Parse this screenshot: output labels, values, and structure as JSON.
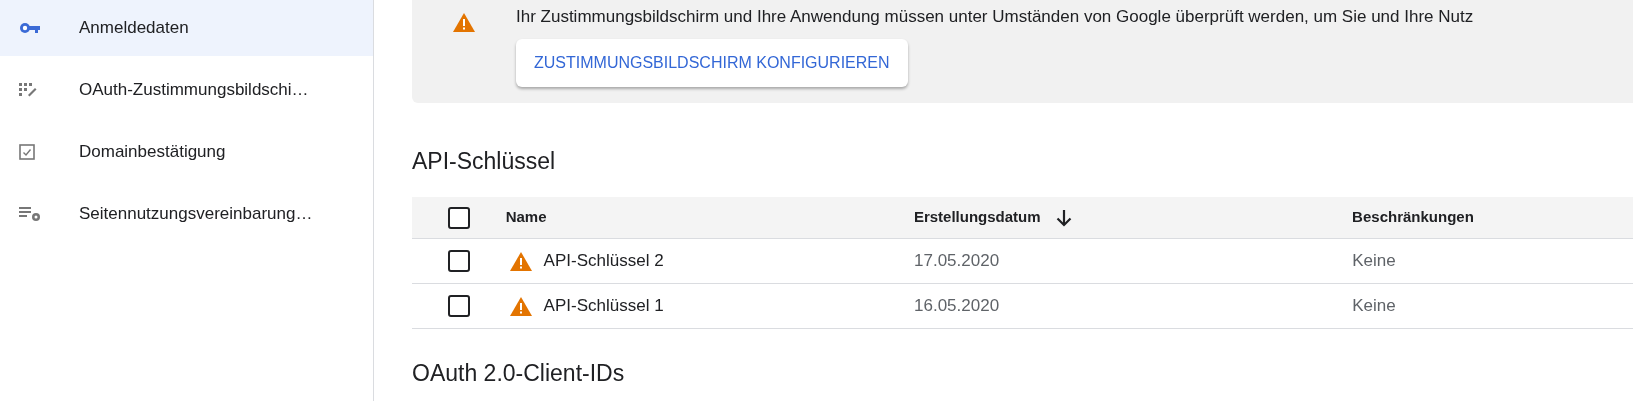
{
  "sidebar": {
    "items": [
      {
        "label": "Anmeldedaten",
        "selected": true
      },
      {
        "label": "OAuth-Zustimmungsbildschi…",
        "selected": false
      },
      {
        "label": "Domainbestätigung",
        "selected": false
      },
      {
        "label": "Seitennutzungsvereinbarung…",
        "selected": false
      }
    ]
  },
  "banner": {
    "message": "Ihr Zustimmungsbildschirm und Ihre Anwendung müssen unter Umständen von Google überprüft werden, um Sie und Ihre Nutz",
    "button": "ZUSTIMMUNGSBILDSCHIRM KONFIGURIEREN"
  },
  "api_keys": {
    "title": "API-Schlüssel",
    "select_all": {
      "checked": false
    },
    "columns": [
      {
        "label": "Name",
        "sorted": false
      },
      {
        "label": "Erstellungsdatum",
        "sorted": true
      },
      {
        "label": "Beschränkungen",
        "sorted": false
      }
    ],
    "rows": [
      {
        "checked": false,
        "warning": true,
        "name": "API-Schlüssel 2",
        "created": "17.05.2020",
        "restrictions": "Keine"
      },
      {
        "checked": false,
        "warning": true,
        "name": "API-Schlüssel 1",
        "created": "16.05.2020",
        "restrictions": "Keine"
      }
    ]
  },
  "next_section": {
    "title": "OAuth 2.0-Client-IDs"
  }
}
